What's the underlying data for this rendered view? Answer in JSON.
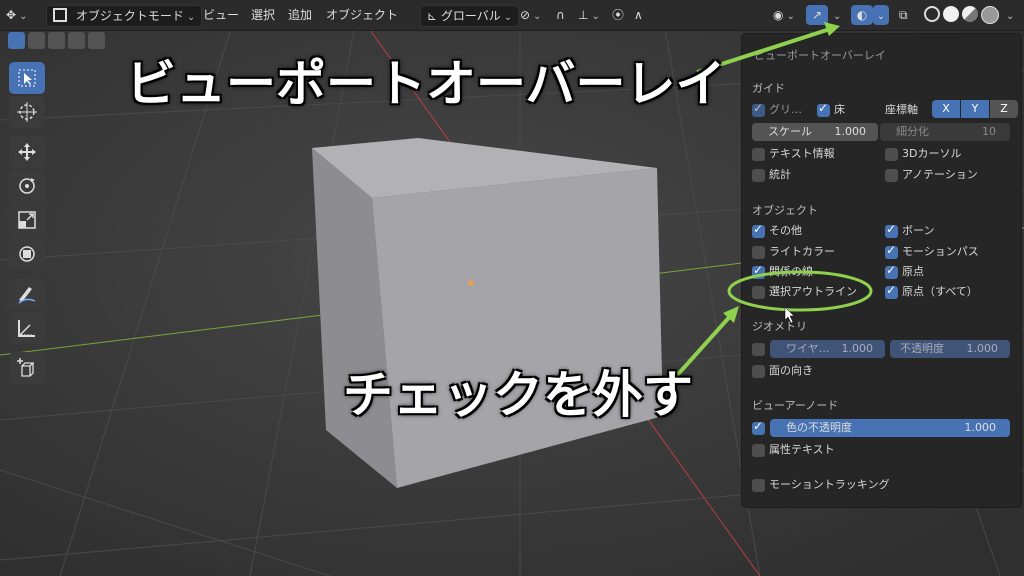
{
  "topbar": {
    "mode": "オブジェクトモード",
    "menu": [
      "ビュー",
      "選択",
      "追加",
      "オブジェクト"
    ],
    "transform": "グローバル"
  },
  "panel": {
    "title": "ビューポートオーバーレイ",
    "guides": {
      "heading": "ガイド",
      "grid": "グリ…",
      "floor": "床",
      "axes_label": "座標軸",
      "axes": [
        "X",
        "Y",
        "Z"
      ],
      "scale_label": "スケール",
      "scale_value": "1.000",
      "subdiv_label": "細分化",
      "subdiv_value": "10",
      "text_info": "テキスト情報",
      "cursor_3d": "3Dカーソル",
      "stats": "統計",
      "annotation": "アノテーション"
    },
    "objects": {
      "heading": "オブジェクト",
      "extras": "その他",
      "bones": "ボーン",
      "light_colors": "ライトカラー",
      "motion_paths": "モーションパス",
      "relationship_lines": "関係の線",
      "origins": "原点",
      "outline_selected": "選択アウトライン",
      "origins_all": "原点（すべて）"
    },
    "geometry": {
      "heading": "ジオメトリ",
      "wireframe_label": "ワイヤ…",
      "wireframe_value": "1.000",
      "opacity_label": "不透明度",
      "opacity_value": "1.000",
      "face_orientation": "面の向き"
    },
    "viewer_node": {
      "heading": "ビューアーノード",
      "color_opacity_label": "色の不透明度",
      "color_opacity_value": "1.000",
      "attribute_text": "属性テキスト"
    },
    "motion_tracking": "モーショントラッキング"
  },
  "annotations": {
    "title": "ビューポートオーバーレイ",
    "instruction": "チェックを外す"
  },
  "colors": {
    "accent": "#4772b3",
    "highlight": "#8fd14f",
    "panel_bg": "#262626",
    "viewport_bg": "#3d3d3d"
  }
}
